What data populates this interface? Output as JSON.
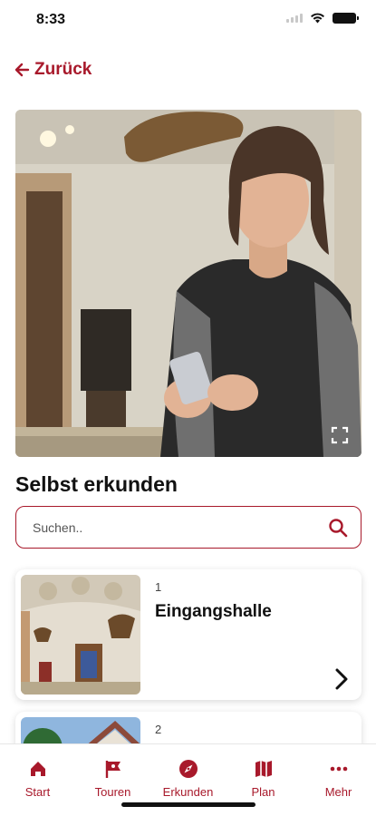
{
  "status_bar": {
    "time": "8:33"
  },
  "nav": {
    "back_label": "Zurück"
  },
  "hero": {
    "media": "photo of a woman holding a smartphone in a museum hall",
    "fullscreen_icon": "fullscreen-icon"
  },
  "section": {
    "title": "Selbst erkunden"
  },
  "search": {
    "placeholder": "Suchen..",
    "value": ""
  },
  "stations": [
    {
      "number": "1",
      "title": "Eingangshalle"
    },
    {
      "number": "2",
      "title": ""
    }
  ],
  "tabs": [
    {
      "label": "Start",
      "icon": "home-icon"
    },
    {
      "label": "Touren",
      "icon": "flag-icon"
    },
    {
      "label": "Erkunden",
      "icon": "compass-icon"
    },
    {
      "label": "Plan",
      "icon": "map-icon"
    },
    {
      "label": "Mehr",
      "icon": "more-icon"
    }
  ],
  "colors": {
    "accent": "#a8192b",
    "background": "#ffffff",
    "text": "#111111"
  }
}
